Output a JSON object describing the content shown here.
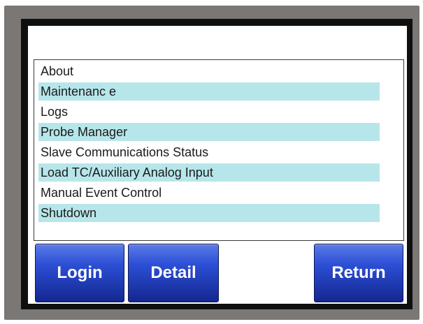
{
  "menu": {
    "items": [
      {
        "label": "About"
      },
      {
        "label": "Maintenanc e"
      },
      {
        "label": "Logs"
      },
      {
        "label": "Probe Manager"
      },
      {
        "label": "Slave Communications Status"
      },
      {
        "label": "Load TC/Auxiliary Analog Input"
      },
      {
        "label": "Manual Event Control"
      },
      {
        "label": "Shutdown"
      }
    ]
  },
  "buttons": {
    "login": "Login",
    "detail": "Detail",
    "return": "Return"
  },
  "colors": {
    "bezel": "#7b7775",
    "frame": "#0f0f0f",
    "row_highlight": "#b7e6ea",
    "button_top": "#5b7ce6",
    "button_bottom": "#14278f"
  }
}
